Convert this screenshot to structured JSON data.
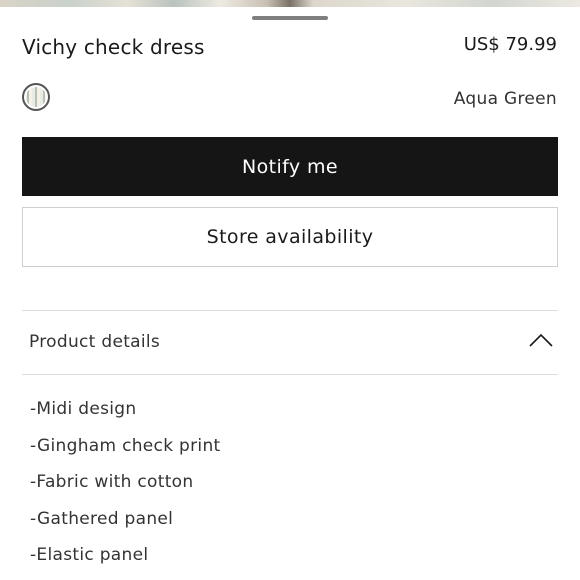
{
  "product": {
    "title": "Vichy check dress",
    "price": "US$ 79.99",
    "color_name": "Aqua Green"
  },
  "actions": {
    "notify_label": "Notify me",
    "store_label": "Store availability"
  },
  "details": {
    "header": "Product details",
    "expanded": true,
    "items": [
      "-Midi design",
      "-Gingham check print",
      "-Fabric with cotton",
      "-Gathered panel",
      "-Elastic panel"
    ]
  },
  "icons": {
    "collapse": "chevron-up-icon"
  },
  "colors": {
    "primary_button": "#151515",
    "primary_button_text": "#ffffff",
    "border": "#cfcfcf"
  }
}
